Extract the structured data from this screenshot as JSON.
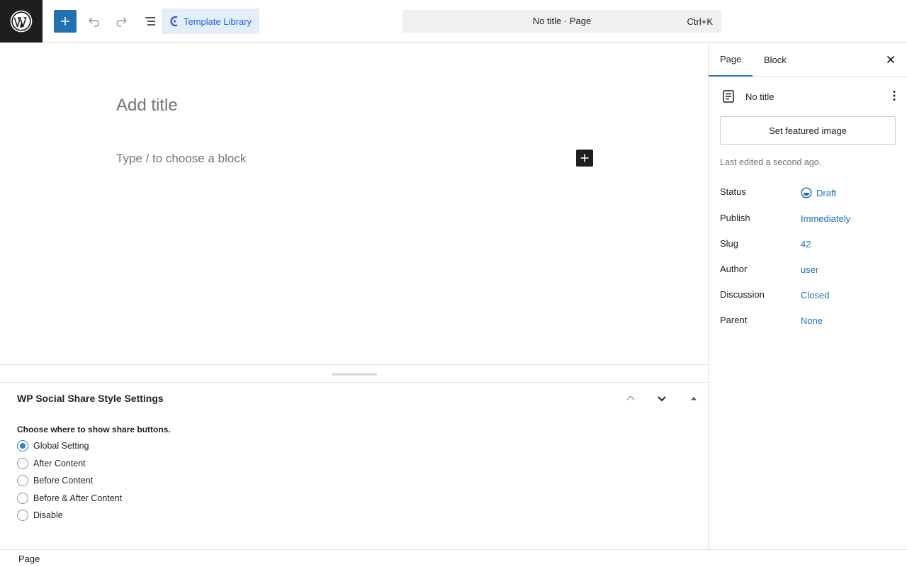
{
  "header": {
    "template_library_label": "Template Library",
    "command_title": "No title · Page",
    "command_shortcut": "Ctrl+K"
  },
  "editor": {
    "title_placeholder": "Add title",
    "block_placeholder": "Type / to choose a block"
  },
  "metabox": {
    "title": "WP Social Share Style Settings",
    "choose_label": "Choose where to show share buttons.",
    "options": [
      {
        "label": "Global Setting",
        "checked": true
      },
      {
        "label": "After Content",
        "checked": false
      },
      {
        "label": "Before Content",
        "checked": false
      },
      {
        "label": "Before & After Content",
        "checked": false
      },
      {
        "label": "Disable",
        "checked": false
      }
    ]
  },
  "footer": {
    "breadcrumb": "Page"
  },
  "sidebar": {
    "tabs": [
      {
        "label": "Page",
        "active": true
      },
      {
        "label": "Block",
        "active": false
      }
    ],
    "document_title": "No title",
    "featured_image_label": "Set featured image",
    "last_edited": "Last edited a second ago.",
    "rows": [
      {
        "label": "Status",
        "value": "Draft"
      },
      {
        "label": "Publish",
        "value": "Immediately"
      },
      {
        "label": "Slug",
        "value": "42"
      },
      {
        "label": "Author",
        "value": "user"
      },
      {
        "label": "Discussion",
        "value": "Closed"
      },
      {
        "label": "Parent",
        "value": "None"
      }
    ]
  },
  "colors": {
    "accent": "#2271b1",
    "template_library_bg": "#e3eefb",
    "template_library_text": "#2562d9"
  },
  "icons": [
    "wordpress-logo",
    "plus-icon",
    "undo-icon",
    "redo-icon",
    "list-view-icon",
    "template-library-icon",
    "close-icon",
    "page-icon",
    "more-vertical-icon",
    "draft-status-icon",
    "chevron-up-icon",
    "chevron-down-icon",
    "caret-up-icon"
  ]
}
